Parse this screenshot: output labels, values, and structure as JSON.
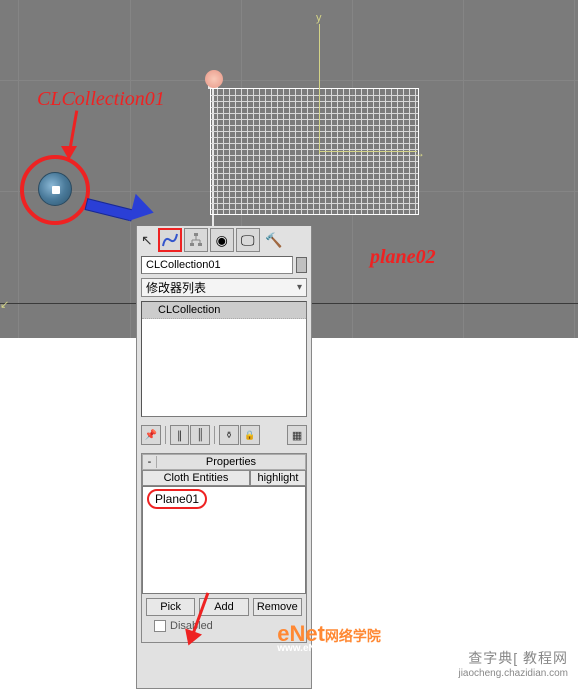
{
  "labels": {
    "clcollection": "CLCollection01",
    "plane02_a": "plane",
    "plane02_b": "02",
    "axis_y": "y"
  },
  "panel": {
    "object_name": "CLCollection01",
    "modifier_dropdown": "修改器列表",
    "stack_item": "CLCollection"
  },
  "rollout": {
    "toggle": "-",
    "title": "Properties",
    "cloth_entities_btn": "Cloth Entities",
    "highlight_btn": "highlight",
    "entity0": "Plane01",
    "pick_btn": "Pick",
    "add_btn": "Add",
    "remove_btn": "Remove",
    "disabled_label": "Disabled"
  },
  "watermarks": {
    "enet_a": "eNet",
    "enet_b": "网络学院",
    "enet_url": "www.eNet.com.cn/eschool",
    "zd_a": "查字典",
    "zd_b": "教程网",
    "zd_url": "jiaocheng.chazidian.com"
  },
  "icons": {
    "cursor": "↖",
    "modify_tab": "〰",
    "hierarchy": "⚙",
    "motion": "◉",
    "display": "🖵",
    "utilities": "🔨",
    "pin": "📌",
    "stack_a": "∥",
    "stack_b": "║",
    "stack_c": "⚱",
    "stack_d": "🔒",
    "stack_e": "▦"
  }
}
